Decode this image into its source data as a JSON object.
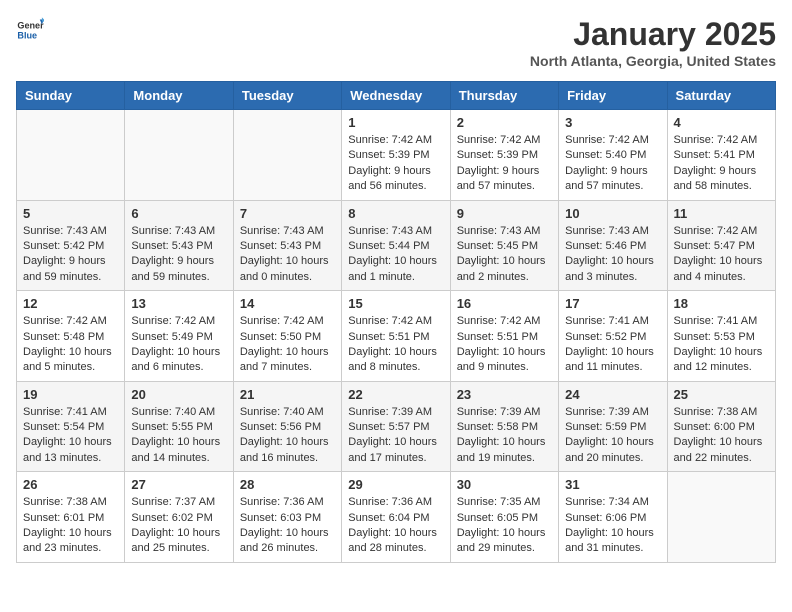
{
  "header": {
    "logo_general": "General",
    "logo_blue": "Blue",
    "month_title": "January 2025",
    "location": "North Atlanta, Georgia, United States"
  },
  "days_of_week": [
    "Sunday",
    "Monday",
    "Tuesday",
    "Wednesday",
    "Thursday",
    "Friday",
    "Saturday"
  ],
  "weeks": [
    [
      {
        "day": "",
        "content": ""
      },
      {
        "day": "",
        "content": ""
      },
      {
        "day": "",
        "content": ""
      },
      {
        "day": "1",
        "content": "Sunrise: 7:42 AM\nSunset: 5:39 PM\nDaylight: 9 hours and 56 minutes."
      },
      {
        "day": "2",
        "content": "Sunrise: 7:42 AM\nSunset: 5:39 PM\nDaylight: 9 hours and 57 minutes."
      },
      {
        "day": "3",
        "content": "Sunrise: 7:42 AM\nSunset: 5:40 PM\nDaylight: 9 hours and 57 minutes."
      },
      {
        "day": "4",
        "content": "Sunrise: 7:42 AM\nSunset: 5:41 PM\nDaylight: 9 hours and 58 minutes."
      }
    ],
    [
      {
        "day": "5",
        "content": "Sunrise: 7:43 AM\nSunset: 5:42 PM\nDaylight: 9 hours and 59 minutes."
      },
      {
        "day": "6",
        "content": "Sunrise: 7:43 AM\nSunset: 5:43 PM\nDaylight: 9 hours and 59 minutes."
      },
      {
        "day": "7",
        "content": "Sunrise: 7:43 AM\nSunset: 5:43 PM\nDaylight: 10 hours and 0 minutes."
      },
      {
        "day": "8",
        "content": "Sunrise: 7:43 AM\nSunset: 5:44 PM\nDaylight: 10 hours and 1 minute."
      },
      {
        "day": "9",
        "content": "Sunrise: 7:43 AM\nSunset: 5:45 PM\nDaylight: 10 hours and 2 minutes."
      },
      {
        "day": "10",
        "content": "Sunrise: 7:43 AM\nSunset: 5:46 PM\nDaylight: 10 hours and 3 minutes."
      },
      {
        "day": "11",
        "content": "Sunrise: 7:42 AM\nSunset: 5:47 PM\nDaylight: 10 hours and 4 minutes."
      }
    ],
    [
      {
        "day": "12",
        "content": "Sunrise: 7:42 AM\nSunset: 5:48 PM\nDaylight: 10 hours and 5 minutes."
      },
      {
        "day": "13",
        "content": "Sunrise: 7:42 AM\nSunset: 5:49 PM\nDaylight: 10 hours and 6 minutes."
      },
      {
        "day": "14",
        "content": "Sunrise: 7:42 AM\nSunset: 5:50 PM\nDaylight: 10 hours and 7 minutes."
      },
      {
        "day": "15",
        "content": "Sunrise: 7:42 AM\nSunset: 5:51 PM\nDaylight: 10 hours and 8 minutes."
      },
      {
        "day": "16",
        "content": "Sunrise: 7:42 AM\nSunset: 5:51 PM\nDaylight: 10 hours and 9 minutes."
      },
      {
        "day": "17",
        "content": "Sunrise: 7:41 AM\nSunset: 5:52 PM\nDaylight: 10 hours and 11 minutes."
      },
      {
        "day": "18",
        "content": "Sunrise: 7:41 AM\nSunset: 5:53 PM\nDaylight: 10 hours and 12 minutes."
      }
    ],
    [
      {
        "day": "19",
        "content": "Sunrise: 7:41 AM\nSunset: 5:54 PM\nDaylight: 10 hours and 13 minutes."
      },
      {
        "day": "20",
        "content": "Sunrise: 7:40 AM\nSunset: 5:55 PM\nDaylight: 10 hours and 14 minutes."
      },
      {
        "day": "21",
        "content": "Sunrise: 7:40 AM\nSunset: 5:56 PM\nDaylight: 10 hours and 16 minutes."
      },
      {
        "day": "22",
        "content": "Sunrise: 7:39 AM\nSunset: 5:57 PM\nDaylight: 10 hours and 17 minutes."
      },
      {
        "day": "23",
        "content": "Sunrise: 7:39 AM\nSunset: 5:58 PM\nDaylight: 10 hours and 19 minutes."
      },
      {
        "day": "24",
        "content": "Sunrise: 7:39 AM\nSunset: 5:59 PM\nDaylight: 10 hours and 20 minutes."
      },
      {
        "day": "25",
        "content": "Sunrise: 7:38 AM\nSunset: 6:00 PM\nDaylight: 10 hours and 22 minutes."
      }
    ],
    [
      {
        "day": "26",
        "content": "Sunrise: 7:38 AM\nSunset: 6:01 PM\nDaylight: 10 hours and 23 minutes."
      },
      {
        "day": "27",
        "content": "Sunrise: 7:37 AM\nSunset: 6:02 PM\nDaylight: 10 hours and 25 minutes."
      },
      {
        "day": "28",
        "content": "Sunrise: 7:36 AM\nSunset: 6:03 PM\nDaylight: 10 hours and 26 minutes."
      },
      {
        "day": "29",
        "content": "Sunrise: 7:36 AM\nSunset: 6:04 PM\nDaylight: 10 hours and 28 minutes."
      },
      {
        "day": "30",
        "content": "Sunrise: 7:35 AM\nSunset: 6:05 PM\nDaylight: 10 hours and 29 minutes."
      },
      {
        "day": "31",
        "content": "Sunrise: 7:34 AM\nSunset: 6:06 PM\nDaylight: 10 hours and 31 minutes."
      },
      {
        "day": "",
        "content": ""
      }
    ]
  ]
}
